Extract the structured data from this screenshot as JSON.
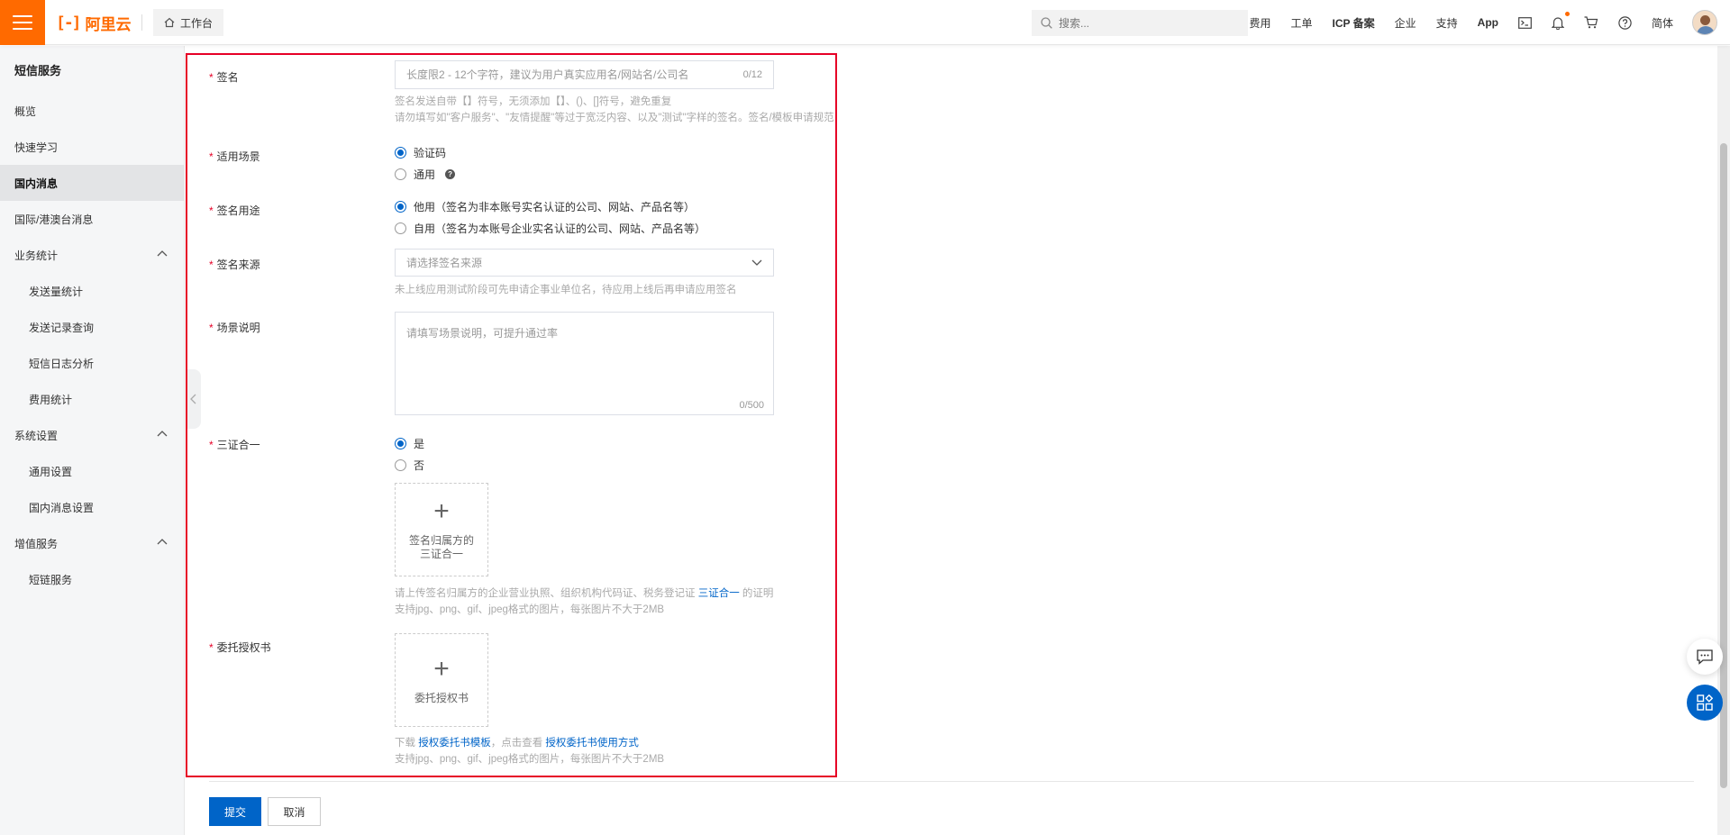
{
  "header": {
    "logo_text": "阿里云",
    "workbench_label": "工作台",
    "search_placeholder": "搜索...",
    "nav": [
      "费用",
      "工单",
      "ICP 备案",
      "企业",
      "支持",
      "App"
    ],
    "lang_label": "简体",
    "accent_color": "#ff6a00"
  },
  "sidebar": {
    "title": "短信服务",
    "items": [
      {
        "label": "概览"
      },
      {
        "label": "快速学习"
      },
      {
        "label": "国内消息"
      },
      {
        "label": "国际/港澳台消息"
      }
    ],
    "groups": [
      {
        "label": "业务统计",
        "items": [
          "发送量统计",
          "发送记录查询",
          "短信日志分析",
          "费用统计"
        ]
      },
      {
        "label": "系统设置",
        "items": [
          "通用设置",
          "国内消息设置"
        ]
      },
      {
        "label": "增值服务",
        "items": [
          "短链服务"
        ]
      }
    ]
  },
  "form": {
    "signature": {
      "label": "签名",
      "placeholder": "长度限2 - 12个字符，建议为用户真实应用名/网站名/公司名",
      "counter": "0/12",
      "hint1": "签名发送自带【】符号，无须添加【】、()、[]符号，避免重复",
      "hint2": "请勿填写如\"客户服务\"、\"友情提醒\"等过于宽泛内容、以及\"测试\"字样的签名。签名/模板申请规范"
    },
    "scenario": {
      "label": "适用场景",
      "options": [
        "验证码",
        "通用"
      ],
      "selected": 0
    },
    "usage": {
      "label": "签名用途",
      "options": [
        "他用（签名为非本账号实名认证的公司、网站、产品名等）",
        "自用（签名为本账号企业实名认证的公司、网站、产品名等）"
      ],
      "selected": 0
    },
    "source": {
      "label": "签名来源",
      "placeholder": "请选择签名来源",
      "hint": "未上线应用测试阶段可先申请企事业单位名，待应用上线后再申请应用签名"
    },
    "description": {
      "label": "场景说明",
      "placeholder": "请填写场景说明，可提升通过率",
      "counter": "0/500"
    },
    "three_in_one": {
      "label": "三证合一",
      "options": [
        "是",
        "否"
      ],
      "selected": 0,
      "upload_line1": "签名归属方的",
      "upload_line2": "三证合一",
      "hint_prefix": "请上传签名归属方的企业营业执照、组织机构代码证、税务登记证",
      "hint_link": "三证合一",
      "hint_suffix": "的证明",
      "hint2": "支持jpg、png、gif、jpeg格式的图片，每张图片不大于2MB"
    },
    "authorization": {
      "label": "委托授权书",
      "upload_label": "委托授权书",
      "hint_prefix": "下载",
      "hint_link1": "授权委托书模板",
      "hint_mid": "，点击查看",
      "hint_link2": "授权委托书使用方式",
      "hint2": "支持jpg、png、gif、jpeg格式的图片，每张图片不大于2MB"
    },
    "required_mark": "*"
  },
  "actions": {
    "submit": "提交",
    "cancel": "取消",
    "primary_color": "#0064c8"
  }
}
